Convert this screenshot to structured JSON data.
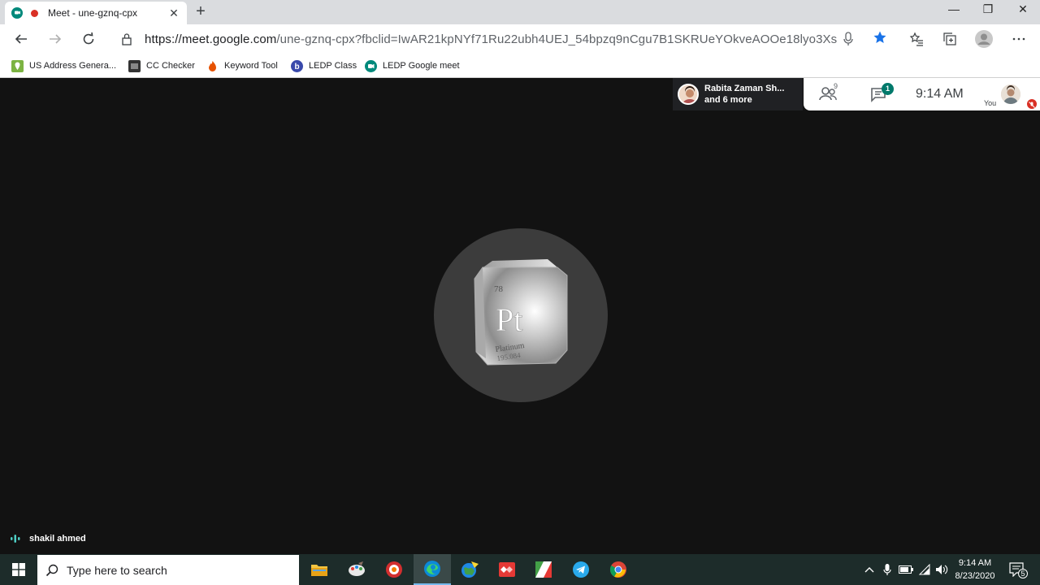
{
  "browser": {
    "tab_title": "Meet - une-gznq-cpx",
    "tab_close": "✕",
    "new_tab": "+",
    "window_controls": {
      "minimize": "—",
      "restore": "❐",
      "close": "✕"
    },
    "url_host": "https://meet.google.com",
    "url_rest": "/une-gznq-cpx?fbclid=IwAR21kpNYf71Ru22ubh4UEJ_54bpzq9nCgu7B1SKRUeYOkveAOOe18lyo3Xs",
    "bookmarks": [
      {
        "label": "US Address Genera...",
        "icon": "map-pin-icon",
        "color": "#7cb342"
      },
      {
        "label": "CC Checker",
        "icon": "card-icon",
        "color": "#333333"
      },
      {
        "label": "Keyword Tool",
        "icon": "flame-icon",
        "color": "#e65100"
      },
      {
        "label": "LEDP Class",
        "icon": "b-logo-icon",
        "color": "#3949ab"
      },
      {
        "label": "LEDP Google meet",
        "icon": "meet-icon",
        "color": "#00897b"
      }
    ]
  },
  "meet": {
    "participants_text_line1": "Rabita Zaman Sh...",
    "participants_text_line2": "and 6 more",
    "people_count": "9",
    "chat_badge": "1",
    "time": "9:14 AM",
    "you_label": "You",
    "presenter_tile": {
      "atomic_number": "78",
      "symbol": "Pt",
      "name": "Platinum",
      "mass": "195.084"
    },
    "speaker_name": "shakil ahmed"
  },
  "taskbar": {
    "search_placeholder": "Type here to search",
    "clock_time": "9:14 AM",
    "clock_date": "8/23/2020",
    "notification_count": "5"
  }
}
